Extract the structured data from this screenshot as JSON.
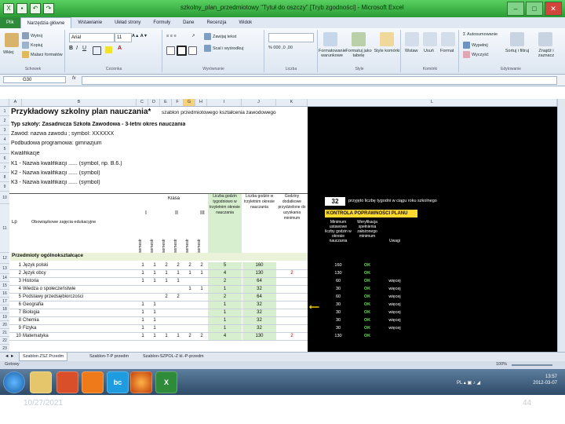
{
  "window": {
    "title": "szkolny_plan_przedmiotowy \"Tytuł do oszczy\" [Tryb zgodności] - Microsoft Excel",
    "controls": [
      "–",
      "□",
      "✕"
    ]
  },
  "ribbon_tabs": [
    "Plik",
    "Narzędzia główne",
    "Wstawianie",
    "Układ strony",
    "Formuły",
    "Dane",
    "Recenzja",
    "Widok"
  ],
  "ribbon": {
    "clipboard": {
      "paste": "Wklej",
      "cut": "Wytnij",
      "copy": "Kopiuj",
      "format_painter": "Malarz formatów",
      "label": "Schowek"
    },
    "font": {
      "name": "Arial",
      "size": "11",
      "label": "Czcionka"
    },
    "alignment": {
      "wrap": "Zawijaj tekst",
      "merge": "Scal i wyśrodkuj",
      "label": "Wyrównanie"
    },
    "number": {
      "label": "Liczba"
    },
    "styles": {
      "cond": "Formatowanie warunkowe",
      "table": "Formatuj jako tabelę",
      "cell": "Style komórki",
      "label": "Style"
    },
    "cells": {
      "insert": "Wstaw",
      "delete": "Usuń",
      "format": "Format",
      "label": "Komórki"
    },
    "editing": {
      "autosum": "Autosumowanie",
      "fill": "Wypełnij",
      "clear": "Wyczyść",
      "sort": "Sortuj i filtruj",
      "find": "Znajdź i zaznacz",
      "label": "Edytowanie"
    }
  },
  "formula_bar": {
    "name_box": "G30",
    "fx": "fx",
    "value": ""
  },
  "columns": [
    "A",
    "B",
    "C",
    "D",
    "E",
    "F",
    "G",
    "H",
    "I",
    "J",
    "K",
    "L"
  ],
  "rows": [
    "1",
    "2",
    "3",
    "4",
    "5",
    "6",
    "7",
    "8",
    "9",
    "10",
    "11",
    "12",
    "13",
    "14",
    "15",
    "16",
    "17",
    "18",
    "19",
    "20",
    "21",
    "22",
    "23"
  ],
  "sheet": {
    "title": "Przykładowy szkolny plan nauczania*",
    "title_note": "szablon przedmiotowego kształcenia zawodowego",
    "line2": "Typ szkoły: Zasadnicza Szkoła Zawodowa - 3-letni okres nauczania",
    "line3": "Zawód: nazwa zawodu ; symbol: XXXXXX",
    "line4": "Podbudowa programowa: gimnazjum",
    "line5": "Kwalifikacje",
    "k1": "K1 - Nazwa kwalifikacji ...... (symbol, np. B.6.)",
    "k2": "K2 - Nazwa kwalifikacji ...... (symbol)",
    "k3": "K3 - Nazwa kwalifikacji ......    (symbol)",
    "hdr_lp": "Lp",
    "hdr_subjects": "Obowiązkowe zajęcia edukacyjne",
    "hdr_klasa": "Klasa",
    "hdr_classes": [
      "I",
      "II",
      "III"
    ],
    "hdr_semestr": "semestr",
    "hdr_hours_week": "Liczba godzin tygodniowo w trzyletnim okresie nauczania",
    "hdr_hours_total": "Liczba godzin w trzyletnim okresie nauczania",
    "hdr_extra": "Godziny dodatkowe przydzielone do uzyskania minimum",
    "section": "Przedmioty ogólnokształcące",
    "subjects": [
      {
        "lp": "1",
        "name": "Język polski",
        "s": [
          "1",
          "1",
          "2",
          "2",
          "2",
          "2"
        ],
        "week": "5",
        "total": "160",
        "extra": ""
      },
      {
        "lp": "2",
        "name": "Język obcy",
        "s": [
          "1",
          "1",
          "1",
          "1",
          "1",
          "1"
        ],
        "week": "4",
        "total": "130",
        "extra": "2"
      },
      {
        "lp": "3",
        "name": "Historia",
        "s": [
          "1",
          "1",
          "1",
          "1",
          "",
          ""
        ],
        "week": "2",
        "total": "64",
        "extra": ""
      },
      {
        "lp": "4",
        "name": "Wiedza o społeczeństwie",
        "s": [
          "",
          "",
          "",
          "",
          "1",
          "1"
        ],
        "week": "1",
        "total": "32",
        "extra": ""
      },
      {
        "lp": "5",
        "name": "Podstawy przedsiębiorczości",
        "s": [
          "",
          "",
          "2",
          "2",
          "",
          ""
        ],
        "week": "2",
        "total": "64",
        "extra": ""
      },
      {
        "lp": "6",
        "name": "Geografia",
        "s": [
          "1",
          "1",
          "",
          "",
          "",
          ""
        ],
        "week": "1",
        "total": "32",
        "extra": ""
      },
      {
        "lp": "7",
        "name": "Biologia",
        "s": [
          "1",
          "1",
          "",
          "",
          "",
          ""
        ],
        "week": "1",
        "total": "32",
        "extra": ""
      },
      {
        "lp": "8",
        "name": "Chemia",
        "s": [
          "1",
          "1",
          "",
          "",
          "",
          ""
        ],
        "week": "1",
        "total": "32",
        "extra": ""
      },
      {
        "lp": "9",
        "name": "Fizyka",
        "s": [
          "1",
          "1",
          "",
          "",
          "",
          ""
        ],
        "week": "1",
        "total": "32",
        "extra": ""
      },
      {
        "lp": "10",
        "name": "Matematyka",
        "s": [
          "1",
          "1",
          "1",
          "1",
          "2",
          "2"
        ],
        "week": "4",
        "total": "130",
        "extra": "2"
      }
    ]
  },
  "control_panel": {
    "number": "32",
    "number_note": "przyjęto liczbę tygodni w ciągu roku szkolnego",
    "title": "KONTROLA POPRAWNOŚCI PLANU",
    "col_min": "Minimum ustawowe liczby godzin w okresie nauczania",
    "col_check": "Weryfikacja spełnienia założonego minimum",
    "col_notes": "Uwagi",
    "rows": [
      {
        "min": "160",
        "check": "OK",
        "note": ""
      },
      {
        "min": "130",
        "check": "OK",
        "note": ""
      },
      {
        "min": "60",
        "check": "OK",
        "note": "więcej"
      },
      {
        "min": "30",
        "check": "OK",
        "note": "więcej"
      },
      {
        "min": "60",
        "check": "OK",
        "note": "więcej"
      },
      {
        "min": "30",
        "check": "OK",
        "note": "więcej"
      },
      {
        "min": "30",
        "check": "OK",
        "note": "więcej"
      },
      {
        "min": "30",
        "check": "OK",
        "note": "więcej"
      },
      {
        "min": "30",
        "check": "OK",
        "note": "więcej"
      },
      {
        "min": "130",
        "check": "OK",
        "note": ""
      }
    ]
  },
  "sheet_tabs": [
    "Szablon ZSZ Przedm",
    "Szablon-T-P przedm",
    "Szablon-SZPOL-Z kl.-P-przedm"
  ],
  "status": {
    "ready": "Gotowy",
    "zoom": "100%"
  },
  "taskbar": {
    "lang": "PL",
    "time": "13:57",
    "date": "2012-03-07"
  },
  "footer": {
    "date": "10/27/2021",
    "page": "44"
  },
  "colors": {
    "titlebar": "#2b9b35",
    "ok": "#5fe04a",
    "green_cell": "#d7efcf",
    "selected_col": "#f7d27a"
  }
}
